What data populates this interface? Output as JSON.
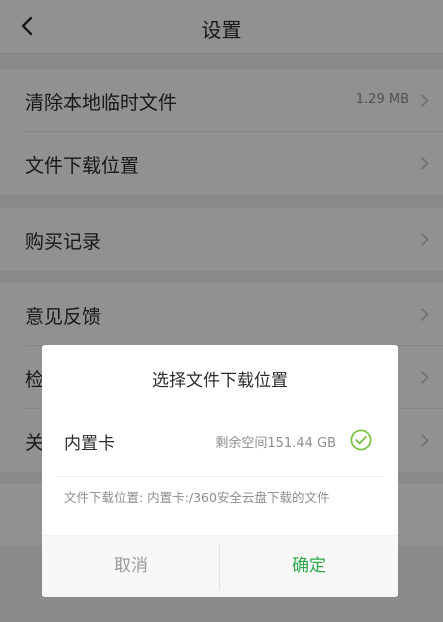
{
  "header": {
    "title": "设置"
  },
  "settings": {
    "items": [
      {
        "label": "清除本地临时文件",
        "value": "1.29 MB"
      },
      {
        "label": "文件下载位置",
        "value": ""
      },
      {
        "label": "购买记录",
        "value": ""
      },
      {
        "label": "意见反馈",
        "value": ""
      },
      {
        "label": "检",
        "value": ""
      },
      {
        "label": "关",
        "value": ""
      }
    ]
  },
  "dialog": {
    "title": "选择文件下载位置",
    "option": {
      "name": "内置卡",
      "space": "剩余空间151.44 GB",
      "selected": true
    },
    "path_text": "文件下载位置: 内置卡:/360安全云盘下载的文件",
    "cancel_label": "取消",
    "confirm_label": "确定"
  },
  "colors": {
    "accent_green": "#2fa84a",
    "overlay": "rgba(0,0,0,0.43)"
  },
  "icons": {
    "back": "back-arrow-icon",
    "chevron": "chevron-right-icon",
    "check": "check-circle-icon"
  }
}
